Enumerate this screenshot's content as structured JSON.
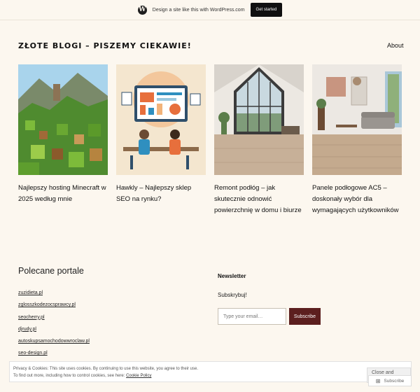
{
  "wp_banner": {
    "text": "Design a site like this with WordPress.com",
    "button": "Get started"
  },
  "header": {
    "site_title": "ZŁOTE BLOGI – PISZEMY CIEKAWIE!",
    "nav": [
      "About"
    ]
  },
  "posts": [
    {
      "title": "Najlepszy hosting Minecraft w 2025 według mnie"
    },
    {
      "title": "Hawkly – Najlepszy sklep SEO na rynku?"
    },
    {
      "title": "Remont podłóg – jak skutecznie odnowić powierzchnię w domu i biurze"
    },
    {
      "title": "Panele podłogowe AC5 – doskonały wybór dla wymagających użytkowników"
    }
  ],
  "portals": {
    "title": "Polecane portale",
    "links": [
      "zuzidieta.pl",
      "zglosszkodezocsprawcy.pl",
      "seocherry.pl",
      "djrudy.pl",
      "autoskupsamochodowwroclaw.pl",
      "seo-design.pl"
    ]
  },
  "newsletter": {
    "title": "Newsletter",
    "subtitle": "Subskrybuj!",
    "email_placeholder": "Type your email…",
    "button": "Subscribe"
  },
  "cookie": {
    "line1": "Privacy & Cookies: This site uses cookies. By continuing to use this website, you agree to their use.",
    "line2": "To find out more, including how to control cookies, see here: ",
    "link": "Cookie Policy",
    "button": "Close and accept"
  },
  "subscribe_bar": {
    "label": "Subscribe"
  }
}
